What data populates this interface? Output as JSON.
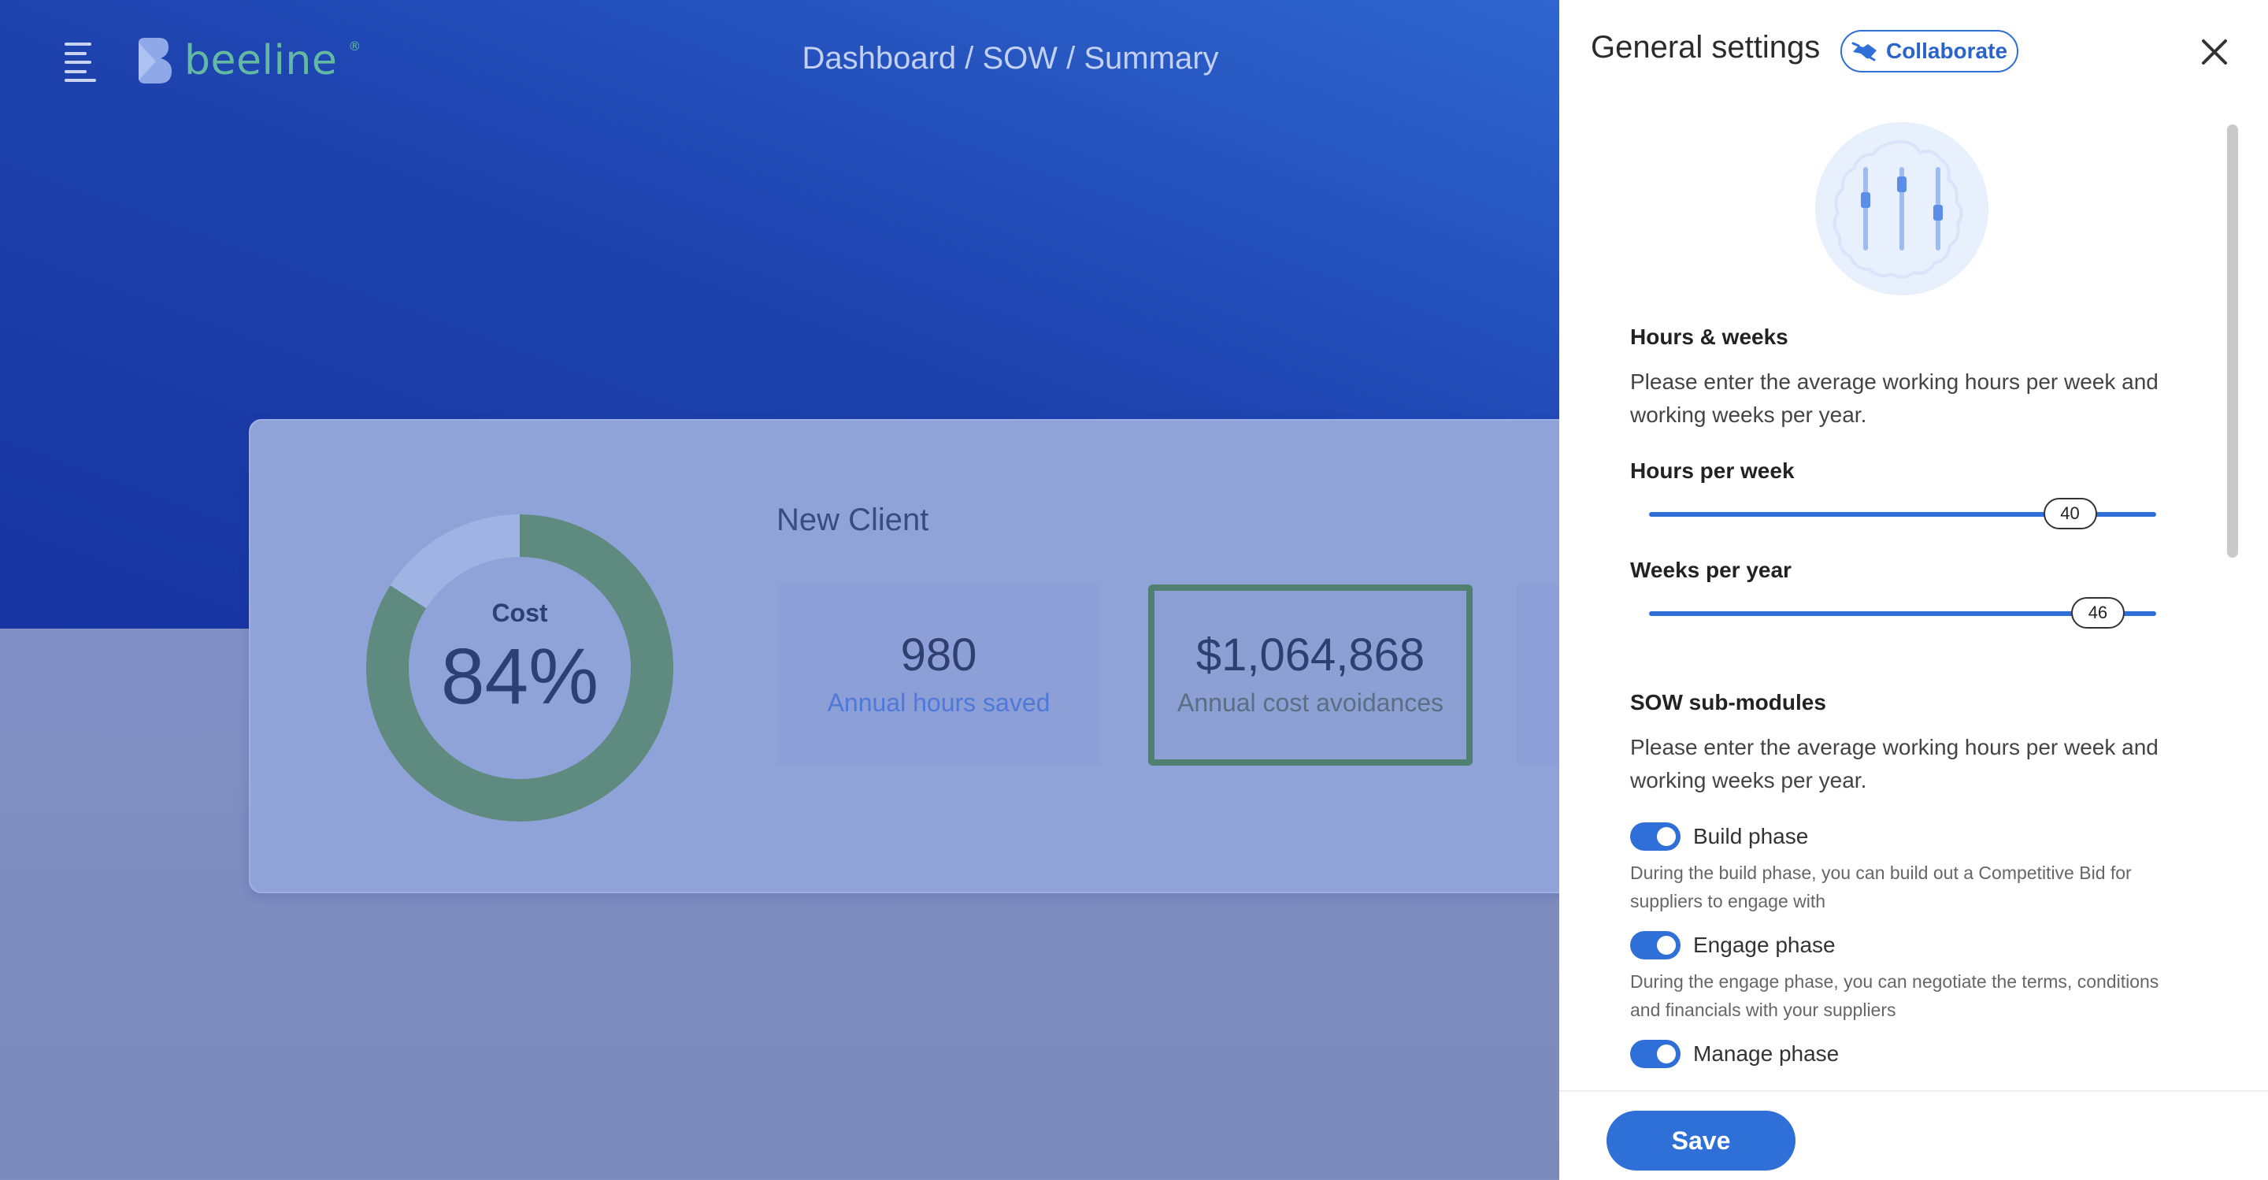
{
  "header": {
    "logo_text": "beeline",
    "breadcrumb": "Dashboard / SOW / Summary"
  },
  "summary_card": {
    "donut": {
      "label": "Cost",
      "value_text": "84%",
      "value": 0.84,
      "color": "#5f8a80",
      "remainder_color": "#a0b3e2"
    },
    "client_name": "New Client",
    "metrics": [
      {
        "value": "980",
        "label": "Annual hours saved"
      },
      {
        "value": "$1,064,868",
        "label": "Annual cost avoidances"
      }
    ]
  },
  "settings_panel": {
    "title": "General settings",
    "collaborate_label": "Collaborate",
    "hours_weeks": {
      "title": "Hours & weeks",
      "description": "Please enter the average working hours per week and working weeks per year.",
      "hours_per_week": {
        "label": "Hours per week",
        "value": "40",
        "fraction": 0.83
      },
      "weeks_per_year": {
        "label": "Weeks per year",
        "value": "46",
        "fraction": 0.885
      }
    },
    "sow_submodules": {
      "title": "SOW sub-modules",
      "description": "Please enter the average working hours per week and working weeks per year.",
      "items": [
        {
          "label": "Build phase",
          "enabled": true,
          "description": "During the build phase, you can build out a Competitive Bid for suppliers to engage with"
        },
        {
          "label": "Engage phase",
          "enabled": true,
          "description": "During the engage phase, you can negotiate the terms, conditions and financials with your suppliers"
        },
        {
          "label": "Manage phase",
          "enabled": true,
          "description": ""
        }
      ]
    },
    "save_label": "Save"
  },
  "colors": {
    "accent": "#2f6fd8",
    "brand_green": "#63b9a2",
    "hero_blue": "#1e44b0"
  }
}
